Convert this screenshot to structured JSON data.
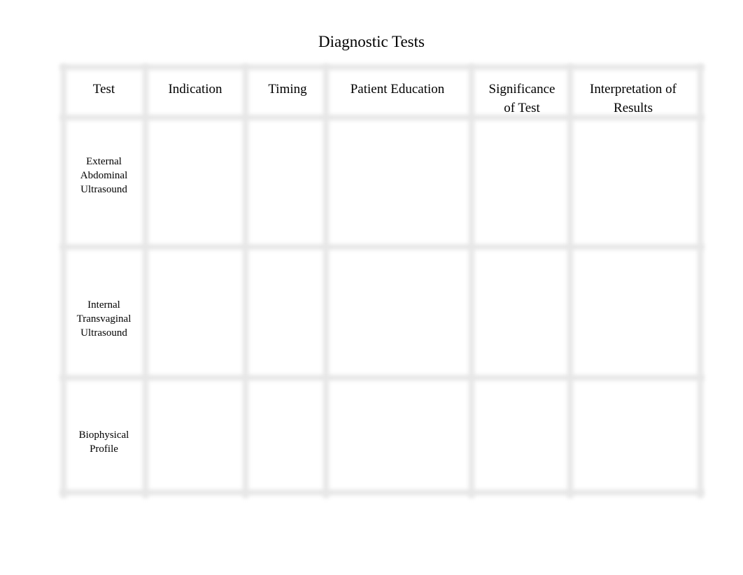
{
  "title": "Diagnostic Tests",
  "table": {
    "headers": [
      "Test",
      "Indication",
      "Timing",
      "Patient Education",
      "Significance of Test",
      "Interpretation of Results"
    ],
    "header_lines": {
      "significance": [
        "Significance",
        "of Test"
      ],
      "interpretation": [
        "Interpretation of",
        "Results"
      ]
    },
    "rows": [
      {
        "test_lines": [
          "External",
          "Abdominal",
          "Ultrasound"
        ],
        "indication": "",
        "timing": "",
        "patient_education": "",
        "significance": "",
        "interpretation": ""
      },
      {
        "test_lines": [
          "Internal",
          "Transvaginal",
          "Ultrasound"
        ],
        "indication": "",
        "timing": "",
        "patient_education": "",
        "significance": "",
        "interpretation": ""
      },
      {
        "test_lines": [
          "Biophysical",
          "Profile"
        ],
        "indication": "",
        "timing": "",
        "patient_education": "",
        "significance": "",
        "interpretation": ""
      }
    ]
  }
}
